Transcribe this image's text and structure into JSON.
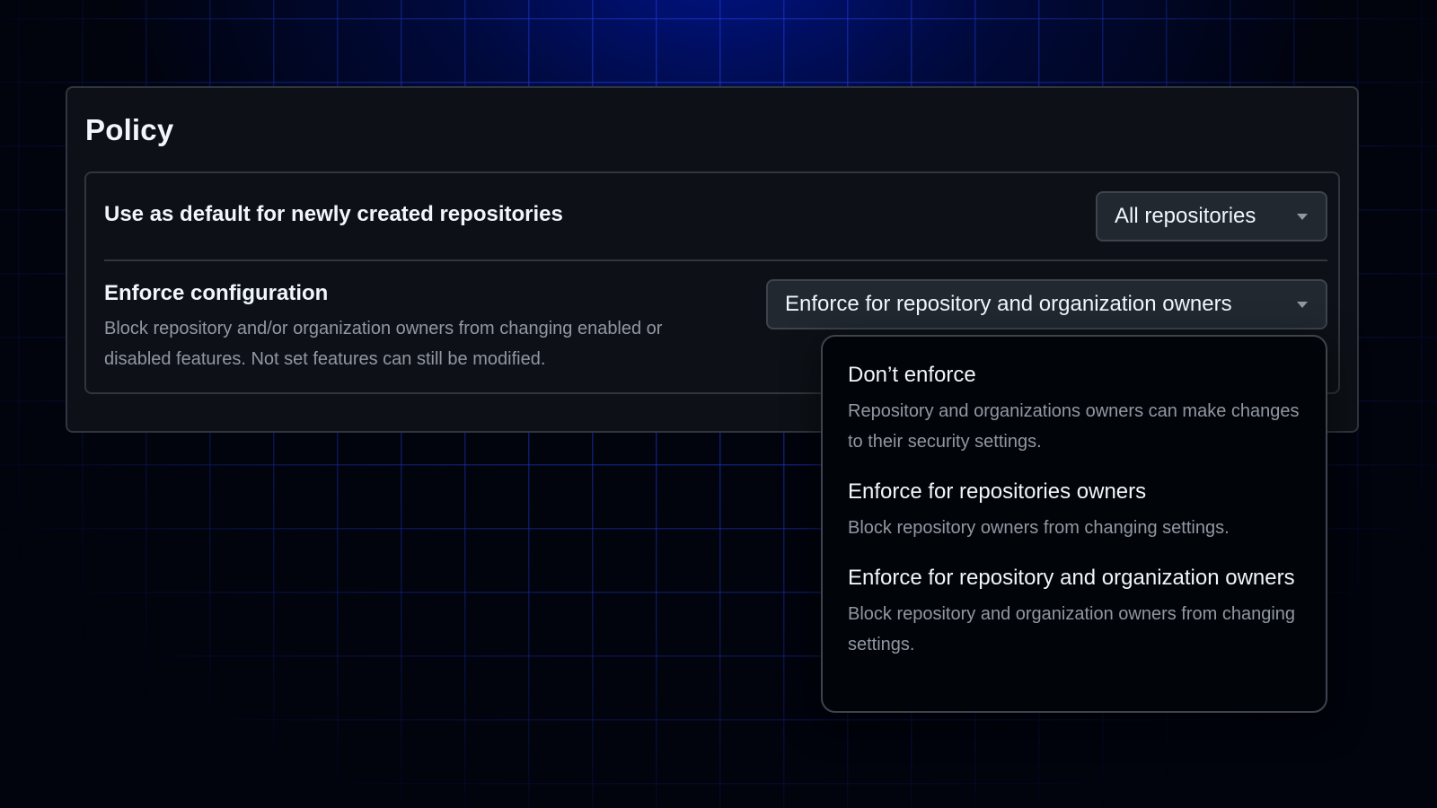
{
  "panel": {
    "title": "Policy"
  },
  "default_row": {
    "label": "Use as default for newly created repositories",
    "select_value": "All repositories"
  },
  "enforce_row": {
    "label": "Enforce configuration",
    "description": "Block repository and/or organization owners from changing enabled or disabled features. Not set features can still be modified.",
    "select_value": "Enforce for repository and organization owners"
  },
  "menu": {
    "options": [
      {
        "title": "Don’t enforce",
        "description": "Repository and organizations owners can make changes to their security settings."
      },
      {
        "title": "Enforce for repositories owners",
        "description": "Block repository owners from changing settings."
      },
      {
        "title": "Enforce for repository and organization owners",
        "description": "Block repository and organization owners from changing settings."
      }
    ]
  },
  "icons": {
    "dropdown": "triangle-down-icon"
  },
  "colors": {
    "panel_bg": "#0d1117",
    "border": "#30363d",
    "select_bg": "#212830",
    "menu_bg": "#010409",
    "text_primary": "#f0f6fc",
    "text_muted": "#9198a1",
    "grid_blue": "#2846ff"
  }
}
